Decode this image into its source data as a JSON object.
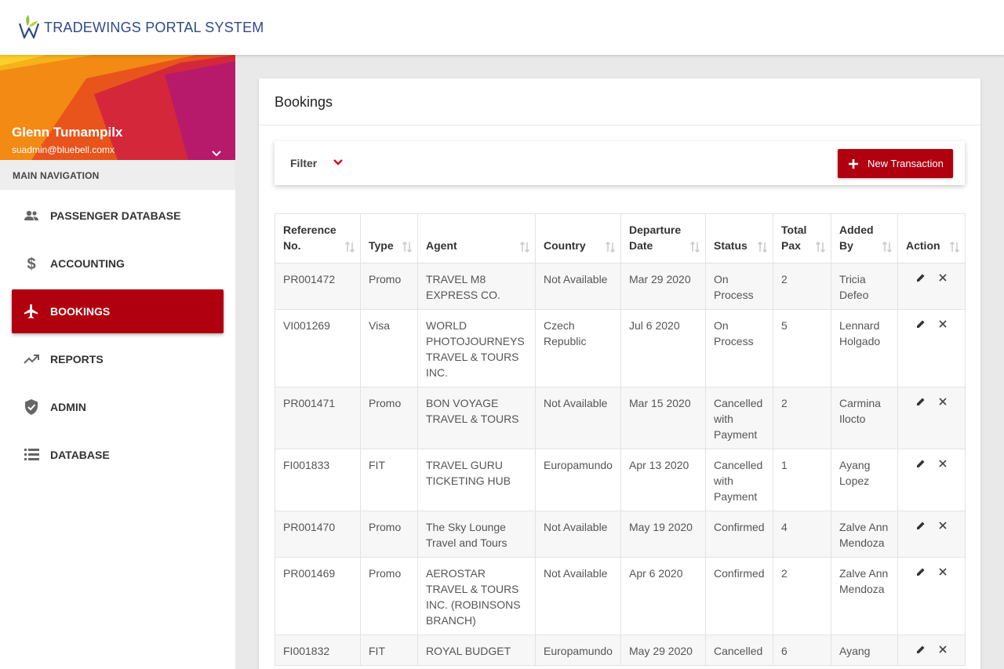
{
  "app": {
    "title": "TRADEWINGS PORTAL SYSTEM",
    "logo_icon": "leaf-w-logo"
  },
  "user": {
    "name": "Glenn Tumampilx",
    "email": "suadmin@bluebell.comx"
  },
  "sidebar": {
    "header": "MAIN NAVIGATION",
    "items": [
      {
        "label": "PASSENGER DATABASE",
        "icon": "people-icon",
        "active": false
      },
      {
        "label": "ACCOUNTING",
        "icon": "dollar-icon",
        "active": false
      },
      {
        "label": "BOOKINGS",
        "icon": "airplane-icon",
        "active": true
      },
      {
        "label": "REPORTS",
        "icon": "trending-up-icon",
        "active": false
      },
      {
        "label": "ADMIN",
        "icon": "shield-check-icon",
        "active": false
      },
      {
        "label": "DATABASE",
        "icon": "list-icon",
        "active": false
      }
    ]
  },
  "main": {
    "title": "Bookings",
    "filter_label": "Filter",
    "new_button_label": "New Transaction"
  },
  "table": {
    "columns": [
      "Reference No.",
      "Type",
      "Agent",
      "Country",
      "Departure Date",
      "Status",
      "Total Pax",
      "Added By",
      "Action"
    ],
    "rows": [
      [
        "PR001472",
        "Promo",
        "TRAVEL M8 EXPRESS CO.",
        "Not Available",
        "Mar 29 2020",
        "On Process",
        "2",
        "Tricia Defeo"
      ],
      [
        "VI001269",
        "Visa",
        "WORLD PHOTOJOURNEYS TRAVEL & TOURS INC.",
        "Czech Republic",
        "Jul 6 2020",
        "On Process",
        "5",
        "Lennard Holgado"
      ],
      [
        "PR001471",
        "Promo",
        "BON VOYAGE TRAVEL & TOURS",
        "Not Available",
        "Mar 15 2020",
        "Cancelled with Payment",
        "2",
        "Carmina Ilocto"
      ],
      [
        "FI001833",
        "FIT",
        "TRAVEL GURU TICKETING HUB",
        "Europamundo",
        "Apr 13 2020",
        "Cancelled with Payment",
        "1",
        "Ayang Lopez"
      ],
      [
        "PR001470",
        "Promo",
        "The Sky Lounge Travel and Tours",
        "Not Available",
        "May 19 2020",
        "Confirmed",
        "4",
        "Zalve Ann Mendoza"
      ],
      [
        "PR001469",
        "Promo",
        "AEROSTAR TRAVEL & TOURS INC. (ROBINSONS BRANCH)",
        "Not Available",
        "Apr 6 2020",
        "Confirmed",
        "2",
        "Zalve Ann Mendoza"
      ],
      [
        "FI001832",
        "FIT",
        "ROYAL BUDGET",
        "Europamundo",
        "May 29 2020",
        "Cancelled",
        "6",
        "Ayang"
      ]
    ]
  },
  "colors": {
    "accent": "#b0000f",
    "brand_text": "#2f4a8a",
    "sidebar_header_bg": "#eeeeee"
  }
}
